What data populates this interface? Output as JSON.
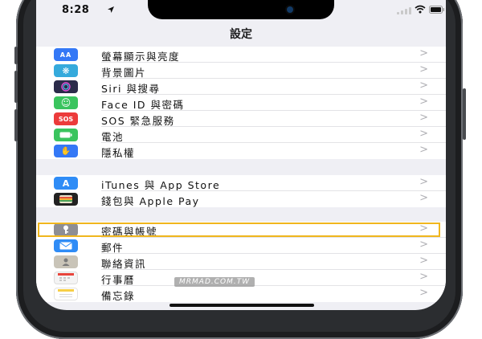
{
  "status_bar": {
    "time": "8:28",
    "location_icon": "location-arrow-icon"
  },
  "nav": {
    "title": "設定"
  },
  "groups": [
    [
      {
        "label": "螢幕顯示與亮度",
        "icon": "display-brightness-icon",
        "icon_text": "AA",
        "color": "#3478f6"
      },
      {
        "label": "背景圖片",
        "icon": "wallpaper-icon",
        "icon_text": "❋",
        "color": "#35aadc"
      },
      {
        "label": "Siri 與搜尋",
        "icon": "siri-icon",
        "icon_text": "",
        "color": "#2b2b4a"
      },
      {
        "label": "Face ID 與密碼",
        "icon": "face-id-icon",
        "icon_text": "☺",
        "color": "#3ac45e"
      },
      {
        "label": "SOS 緊急服務",
        "icon": "sos-icon",
        "icon_text": "SOS",
        "color": "#ec3b3b"
      },
      {
        "label": "電池",
        "icon": "battery-settings-icon",
        "icon_text": "▬",
        "color": "#3ac45e"
      },
      {
        "label": "隱私權",
        "icon": "privacy-hand-icon",
        "icon_text": "✋",
        "color": "#3478f6"
      }
    ],
    [
      {
        "label": "iTunes 與 App Store",
        "icon": "app-store-icon",
        "icon_text": "A",
        "color": "#2f8cf6"
      },
      {
        "label": "錢包與 Apple Pay",
        "icon": "wallet-icon",
        "icon_text": "▤",
        "color": "#222222"
      }
    ],
    [
      {
        "label": "密碼與帳號",
        "icon": "key-icon",
        "icon_text": "⚷",
        "color": "#8e8e93"
      },
      {
        "label": "郵件",
        "icon": "mail-icon",
        "icon_text": "✉",
        "color": "#2f8cf6"
      },
      {
        "label": "聯絡資訊",
        "icon": "contacts-icon",
        "icon_text": "◉",
        "color": "#bcbcbc"
      },
      {
        "label": "行事曆",
        "icon": "calendar-icon",
        "icon_text": "▦",
        "color": "#f2f2f2"
      },
      {
        "label": "備忘錄",
        "icon": "notes-icon",
        "icon_text": "≡",
        "color": "#f7cf46"
      }
    ]
  ],
  "chevron": ">",
  "watermark": "MRMAD.COM.TW",
  "accent_highlight": "#f0b61e"
}
